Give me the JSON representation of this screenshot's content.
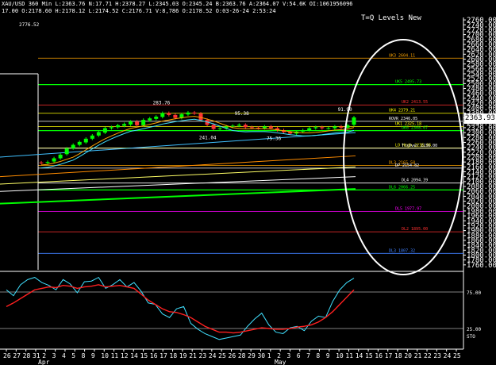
{
  "header": {
    "line1": "XAU/USD 360 Min   L:2363.76  N:17.71  H:2378.27  L:2345.03  O:2345.24  B:2363.76  A:2364.07  V:54.6K  OI:1061956096",
    "line2": "17.00  O:2178.60  H:2178.12  L:2174.52  C:2176.71  V:8,786  O:2178.52  O:03-26-24  2:53:24"
  },
  "top_left_value": "2776.52",
  "last_price": "2363.93",
  "colors": {
    "price_up": "#00ff00",
    "price_down": "#ff3333",
    "sto_k": "#40e0ff",
    "sto_d": "#ff2020",
    "annotation": "#ffffff"
  },
  "chart_data": [
    {
      "type": "candlestick",
      "title": "T=Q Levels New",
      "ylim": [
        1740,
        2770
      ],
      "y_ticks": [
        "2760.00",
        "2740.00",
        "2720.00",
        "2700.00",
        "2680.00",
        "2660.00",
        "2640.00",
        "2620.00",
        "2600.00",
        "2580.00",
        "2560.00",
        "2540.00",
        "2520.00",
        "2500.00",
        "2480.00",
        "2460.00",
        "2440.00",
        "2420.00",
        "2400.00",
        "2380.00",
        "2360.00",
        "2340.00",
        "2320.00",
        "2300.00",
        "2280.00",
        "2260.00",
        "2240.00",
        "2220.00",
        "2200.00",
        "2180.00",
        "2160.00",
        "2140.00",
        "2120.00",
        "2100.00",
        "2080.00",
        "2060.00",
        "2040.00",
        "2020.00",
        "2000.00",
        "1980.00",
        "1960.00",
        "1940.00",
        "1920.00",
        "1900.00",
        "1880.00",
        "1860.00",
        "1840.00",
        "1820.00",
        "1800.00",
        "1780.00",
        "1760.00"
      ],
      "x_ticks": [
        "26",
        "27",
        "28",
        "31",
        "2",
        "3",
        "4",
        "5",
        "8",
        "9",
        "10",
        "11",
        "12",
        "14",
        "15",
        "16",
        "17",
        "18",
        "19",
        "21",
        "23",
        "24",
        "25",
        "26",
        "28",
        "29",
        "30",
        "1",
        "2",
        "3",
        "6",
        "7",
        "8",
        "9",
        "10",
        "11",
        "14",
        "15",
        "16",
        "17",
        "18",
        "20",
        "21",
        "22",
        "23",
        "24",
        "25"
      ],
      "month_labels": [
        "Apr",
        "May"
      ],
      "close": [
        2176,
        2180,
        2195,
        2210,
        2235,
        2250,
        2262,
        2275,
        2288,
        2302,
        2318,
        2322,
        2330,
        2335,
        2345,
        2330,
        2352,
        2358,
        2365,
        2380,
        2372,
        2360,
        2375,
        2382,
        2378,
        2352,
        2332,
        2315,
        2318,
        2325,
        2328,
        2332,
        2322,
        2320,
        2318,
        2325,
        2318,
        2310,
        2302,
        2296,
        2304,
        2310,
        2318,
        2322,
        2318,
        2318,
        2325,
        2320,
        2330,
        2362
      ],
      "open": [
        2178,
        2176,
        2182,
        2195,
        2212,
        2236,
        2250,
        2260,
        2275,
        2288,
        2300,
        2318,
        2322,
        2328,
        2333,
        2345,
        2330,
        2350,
        2356,
        2364,
        2380,
        2372,
        2360,
        2374,
        2382,
        2378,
        2352,
        2332,
        2316,
        2318,
        2325,
        2328,
        2332,
        2322,
        2320,
        2318,
        2325,
        2318,
        2310,
        2302,
        2296,
        2304,
        2310,
        2318,
        2322,
        2318,
        2318,
        2325,
        2320,
        2332
      ],
      "levels": [
        {
          "label": "UK3 2604.11",
          "value": 2604,
          "color": "#ffa500"
        },
        {
          "label": "UK5 2495.73",
          "value": 2496,
          "color": "#00ff00"
        },
        {
          "label": "UK2 2413.55",
          "value": 2413,
          "color": "#ff3030"
        },
        {
          "label": "UK4 2379.21",
          "value": 2379,
          "color": "#ffff00"
        },
        {
          "label": "UK1 2325.18",
          "value": 2325,
          "color": "#ffff00"
        },
        {
          "label": "UK6 2308.07",
          "value": 2308,
          "color": "#00ff00"
        },
        {
          "label": "ROVR 2346.05",
          "value": 2346,
          "color": "#ffffff"
        },
        {
          "label": "LO High 2236.66",
          "value": 2237,
          "color": "#ffff00"
        },
        {
          "label": "TrsOver 2236.00",
          "value": 2236,
          "color": "#ffffff"
        },
        {
          "label": "DL3 2165.58",
          "value": 2166,
          "color": "#ffa500"
        },
        {
          "label": "DP 2154.82",
          "value": 2155,
          "color": "#ffffff"
        },
        {
          "label": "DL4 2094.39",
          "value": 2094,
          "color": "#ffffff"
        },
        {
          "label": "DL6 2066.25",
          "value": 2066,
          "color": "#00ff00"
        },
        {
          "label": "DL5 1977.97",
          "value": 1978,
          "color": "#ff00ff"
        },
        {
          "label": "DL2 1895.00",
          "value": 1895,
          "color": "#ff3030"
        },
        {
          "label": "DL3 1807.32",
          "value": 1807,
          "color": "#4080ff"
        }
      ],
      "annotations": [
        {
          "label": "283.76",
          "x": 0.43,
          "value": 2415
        },
        {
          "label": "91.90",
          "x": 0.95,
          "value": 2388
        },
        {
          "label": "95.38",
          "x": 0.66,
          "value": 2372
        },
        {
          "label": "241.04",
          "x": 0.56,
          "value": 2273
        },
        {
          "label": "75.36",
          "x": 0.75,
          "value": 2270
        }
      ]
    },
    {
      "type": "line",
      "title": "STO",
      "ylim": [
        0,
        100
      ],
      "y_ticks": [
        "75.00",
        "25.00"
      ],
      "levels": [
        75,
        25
      ],
      "series": [
        {
          "name": "",
          "values": [
            78,
            70,
            85,
            92,
            95,
            88,
            84,
            78,
            92,
            86,
            74,
            89,
            90,
            95,
            80,
            85,
            92,
            82,
            88,
            76,
            60,
            58,
            45,
            40,
            52,
            55,
            32,
            24,
            18,
            14,
            10,
            12,
            14,
            16,
            28,
            38,
            46,
            30,
            20,
            18,
            26,
            28,
            22,
            35,
            42,
            40,
            62,
            78,
            88,
            94
          ]
        },
        {
          "name": "",
          "values": [
            55,
            60,
            66,
            72,
            78,
            80,
            82,
            81,
            84,
            83,
            80,
            82,
            83,
            85,
            82,
            83,
            84,
            82,
            80,
            72,
            64,
            58,
            52,
            48,
            47,
            44,
            40,
            34,
            28,
            24,
            20,
            20,
            19,
            20,
            22,
            24,
            26,
            25,
            24,
            24,
            25,
            27,
            28,
            30,
            34,
            40,
            48,
            58,
            68,
            78
          ]
        }
      ]
    }
  ]
}
